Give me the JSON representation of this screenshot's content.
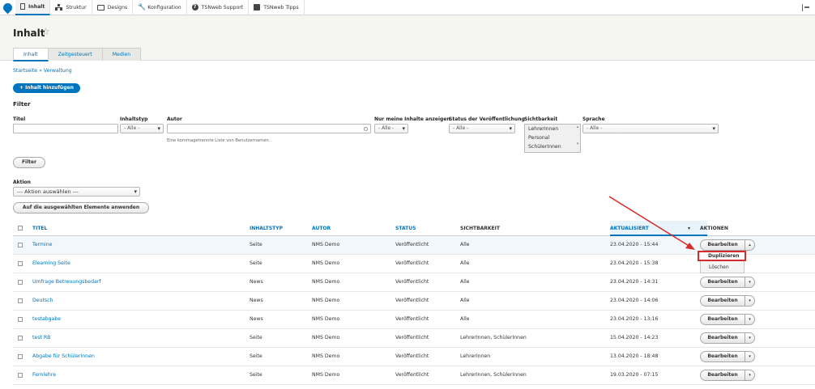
{
  "toolbar": {
    "items": [
      {
        "label": "Inhalt",
        "icon": "page-icon"
      },
      {
        "label": "Struktur",
        "icon": "tree-icon"
      },
      {
        "label": "Designs",
        "icon": "monitor-icon"
      },
      {
        "label": "Konfiguration",
        "icon": "wrench-icon"
      },
      {
        "label": "TSNweb Support",
        "icon": "help-icon"
      },
      {
        "label": "TSNweb Tipps",
        "icon": "puzzle-icon"
      }
    ]
  },
  "header": {
    "title": "Inhalt",
    "tabs": [
      "Inhalt",
      "Zeitgesteuert",
      "Medien"
    ]
  },
  "breadcrumb": "Startseite » Verwaltung",
  "add_button": "+ Inhalt hinzufügen",
  "filter": {
    "heading": "Filter",
    "title_label": "Titel",
    "type_label": "Inhaltstyp",
    "type_value": "- Alle -",
    "author_label": "Autor",
    "author_hint": "Eine kommagetrennte Liste von Benutzernamen.",
    "mine_label": "Nur meine Inhalte anzeigen",
    "mine_value": "- Alle -",
    "status_label": "Status der Veröffentlichung",
    "status_value": "- Alle -",
    "visibility_label": "Sichtbarkeit",
    "visibility_options": [
      "LehrerInnen",
      "Personal",
      "SchülerInnen"
    ],
    "language_label": "Sprache",
    "language_value": "- Alle -",
    "submit": "Filter"
  },
  "bulk": {
    "label": "Aktion",
    "select_value": "--- Aktion auswählen ---",
    "apply": "Auf die ausgewählten Elemente anwenden"
  },
  "table": {
    "headers": {
      "title": "TITEL",
      "type": "INHALTSTYP",
      "author": "AUTOR",
      "status": "STATUS",
      "visibility": "SICHTBARKEIT",
      "updated": "AKTUALISIERT",
      "actions": "AKTIONEN"
    },
    "rows": [
      {
        "title": "Termine",
        "type": "Seite",
        "author": "NMS Demo",
        "status": "Veröffentlicht",
        "visibility": "Alle",
        "updated": "23.04.2020 - 15:44"
      },
      {
        "title": "Elearning Seite",
        "type": "Seite",
        "author": "NMS Demo",
        "status": "Veröffentlicht",
        "visibility": "Alle",
        "updated": "23.04.2020 - 15:38"
      },
      {
        "title": "Umfrage Betreuungsbedarf",
        "type": "News",
        "author": "NMS Demo",
        "status": "Veröffentlicht",
        "visibility": "Alle",
        "updated": "23.04.2020 - 14:31"
      },
      {
        "title": "Deutsch",
        "type": "News",
        "author": "NMS Demo",
        "status": "Veröffentlicht",
        "visibility": "Alle",
        "updated": "23.04.2020 - 14:06"
      },
      {
        "title": "testabgabe",
        "type": "News",
        "author": "NMS Demo",
        "status": "Veröffentlicht",
        "visibility": "Alle",
        "updated": "23.04.2020 - 13:16"
      },
      {
        "title": "test RB",
        "type": "Seite",
        "author": "NMS Demo",
        "status": "Veröffentlicht",
        "visibility": "LehrerInnen, SchülerInnen",
        "updated": "15.04.2020 - 14:23"
      },
      {
        "title": "Abgabe für SchülerInnen",
        "type": "Seite",
        "author": "NMS Demo",
        "status": "Veröffentlicht",
        "visibility": "LehrerInnen",
        "updated": "13.04.2020 - 18:48"
      },
      {
        "title": "Fernlehre",
        "type": "Seite",
        "author": "NMS Demo",
        "status": "Veröffentlicht",
        "visibility": "LehrerInnen, SchülerInnen",
        "updated": "19.03.2020 - 07:15"
      }
    ],
    "edit_label": "Bearbeiten",
    "dropdown": {
      "duplicate": "Duplizieren",
      "delete": "Löschen"
    }
  },
  "colors": {
    "accent": "#0074bd",
    "highlight": "#d42b2b"
  }
}
